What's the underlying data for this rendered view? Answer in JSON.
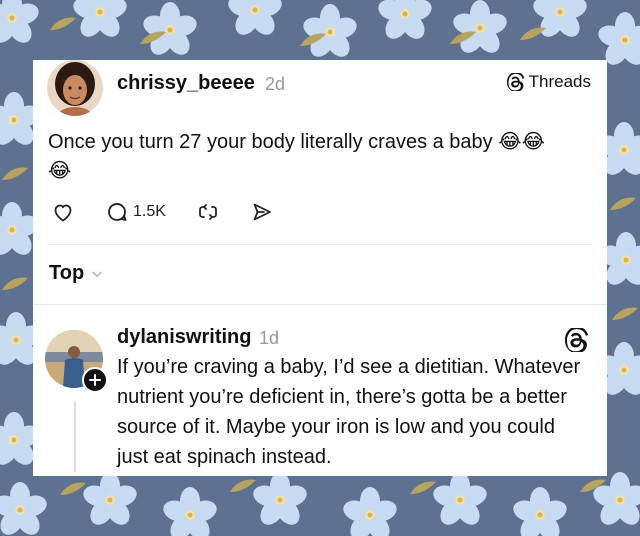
{
  "post": {
    "username": "chrissy_beeee",
    "age": "2d",
    "badge": "Threads",
    "text": "Once you turn 27 your body literally craves a baby 😂😂\n😂",
    "reply_count": "1.5K"
  },
  "section": {
    "sort_label": "Top"
  },
  "reply": {
    "username": "dylaniswriting",
    "age": "1d",
    "text": "If you’re craving a baby, I’d see a dietitian. Whatever nutrient you’re deficient in, there’s gotta be a better source of it. Maybe your iron is low and you could just eat spinach instead."
  },
  "icons": [
    "threads-logo-icon",
    "heart-icon",
    "comment-icon",
    "repost-icon",
    "share-icon",
    "chevron-down-icon",
    "plus-icon"
  ],
  "colors": {
    "background": "#5d7191",
    "flower": "#c7dcf3",
    "card": "#ffffff",
    "muted": "#999999"
  }
}
